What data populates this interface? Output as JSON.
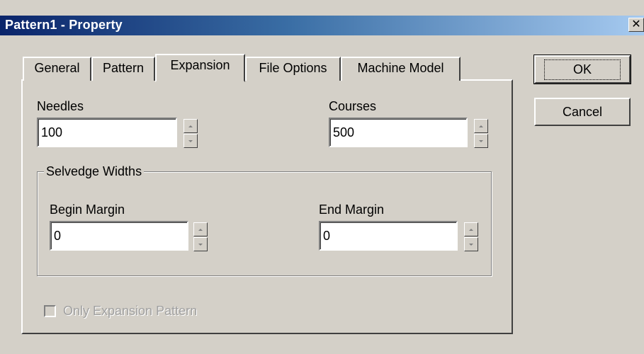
{
  "window": {
    "title": "Pattern1 - Property",
    "close_glyph": "✕"
  },
  "tabs": [
    {
      "label": "General",
      "active": false
    },
    {
      "label": "Pattern",
      "active": false
    },
    {
      "label": "Expansion",
      "active": true
    },
    {
      "label": "File Options",
      "active": false
    },
    {
      "label": "Machine Model",
      "active": false
    }
  ],
  "expansion": {
    "needles": {
      "label": "Needles",
      "value": "100"
    },
    "courses": {
      "label": "Courses",
      "value": "500"
    },
    "selvedge": {
      "legend": "Selvedge Widths",
      "begin_margin": {
        "label": "Begin Margin",
        "value": "0"
      },
      "end_margin": {
        "label": "End Margin",
        "value": "0"
      }
    },
    "only_expansion": {
      "label": "Only Expansion Pattern",
      "checked": false,
      "enabled": false
    }
  },
  "buttons": {
    "ok": "OK",
    "cancel": "Cancel"
  },
  "colors": {
    "face": "#d4d0c8",
    "title_start": "#0a246a",
    "title_end": "#a6caf0",
    "disabled_text": "#a0a0a0"
  },
  "icons": {
    "spin_up": "triangle-up-icon",
    "spin_down": "triangle-down-icon",
    "close": "close-icon"
  }
}
